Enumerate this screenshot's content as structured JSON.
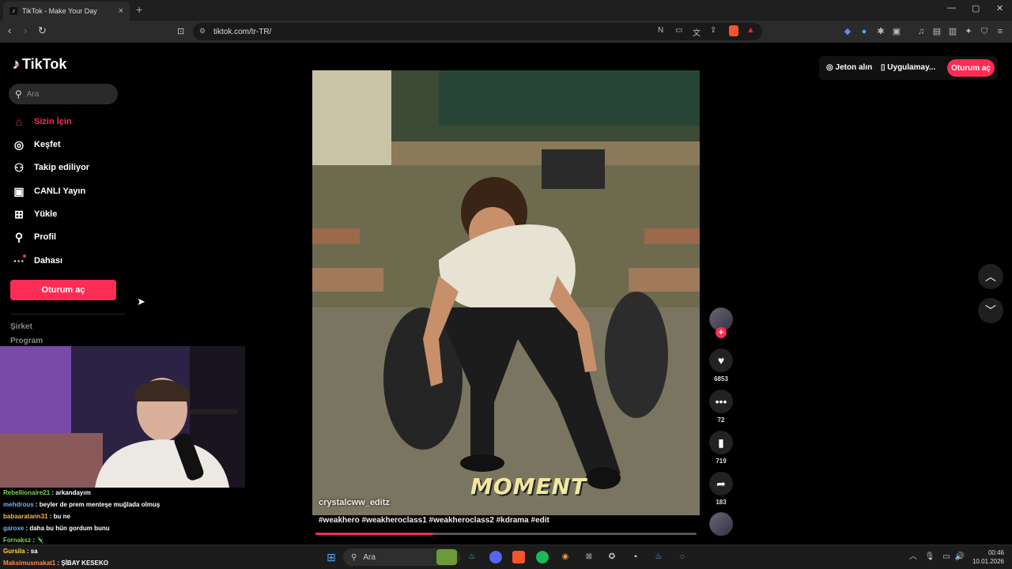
{
  "browser": {
    "tab_title": "TikTok - Make Your Day",
    "url": "tiktok.com/tr-TR/"
  },
  "sidebar": {
    "logo": "TikTok",
    "search_placeholder": "Ara",
    "items": [
      {
        "label": "Sizin İçin",
        "icon": "home-icon",
        "active": true
      },
      {
        "label": "Keşfet",
        "icon": "compass-icon"
      },
      {
        "label": "Takip ediliyor",
        "icon": "following-icon"
      },
      {
        "label": "CANLI Yayın",
        "icon": "live-icon"
      },
      {
        "label": "Yükle",
        "icon": "upload-icon"
      },
      {
        "label": "Profil",
        "icon": "profile-icon"
      },
      {
        "label": "Dahası",
        "icon": "more-icon"
      }
    ],
    "login_label": "Oturum aç",
    "footer": [
      "Şirket",
      "Program"
    ]
  },
  "header": {
    "coins_label": "Jeton alın",
    "app_label": "Uygulamay...",
    "login_label": "Oturum aç"
  },
  "video": {
    "username": "crystalcww_editz",
    "overlay_text": "MOMENT",
    "hashtags": "#weakhero #weakheroclass1 #weakheroclass2 #kdrama #edit",
    "progress": 0.31
  },
  "actions": {
    "likes": "6853",
    "comments": "72",
    "saves": "719",
    "shares": "183"
  },
  "chat": [
    {
      "user": "Rebellionaire21",
      "msg": "arkandayım",
      "color": "#7fd44a"
    },
    {
      "user": "mehdrous",
      "msg": "beyler de prem menteşe muğlada olmuş",
      "color": "#6fb3ff"
    },
    {
      "user": "babaaratann31",
      "msg": "bu ne",
      "color": "#ffb84d"
    },
    {
      "user": "garoxe",
      "msg": "daha bu hün gordum bunu",
      "color": "#6fb3ff"
    },
    {
      "user": "Fornaksz",
      "msg": "",
      "color": "#7fd44a"
    },
    {
      "user": "Gursila",
      "msg": "sa",
      "color": "#ffd54d"
    },
    {
      "user": "Maksimusmakat1",
      "msg": "ŞİBAY KESEKO",
      "color": "#ff8a4d"
    }
  ],
  "taskbar": {
    "search_placeholder": "Ara",
    "time": "00:46",
    "date": "10.01.2026"
  },
  "colors": {
    "accent": "#fe2c55",
    "background": "#000000"
  }
}
